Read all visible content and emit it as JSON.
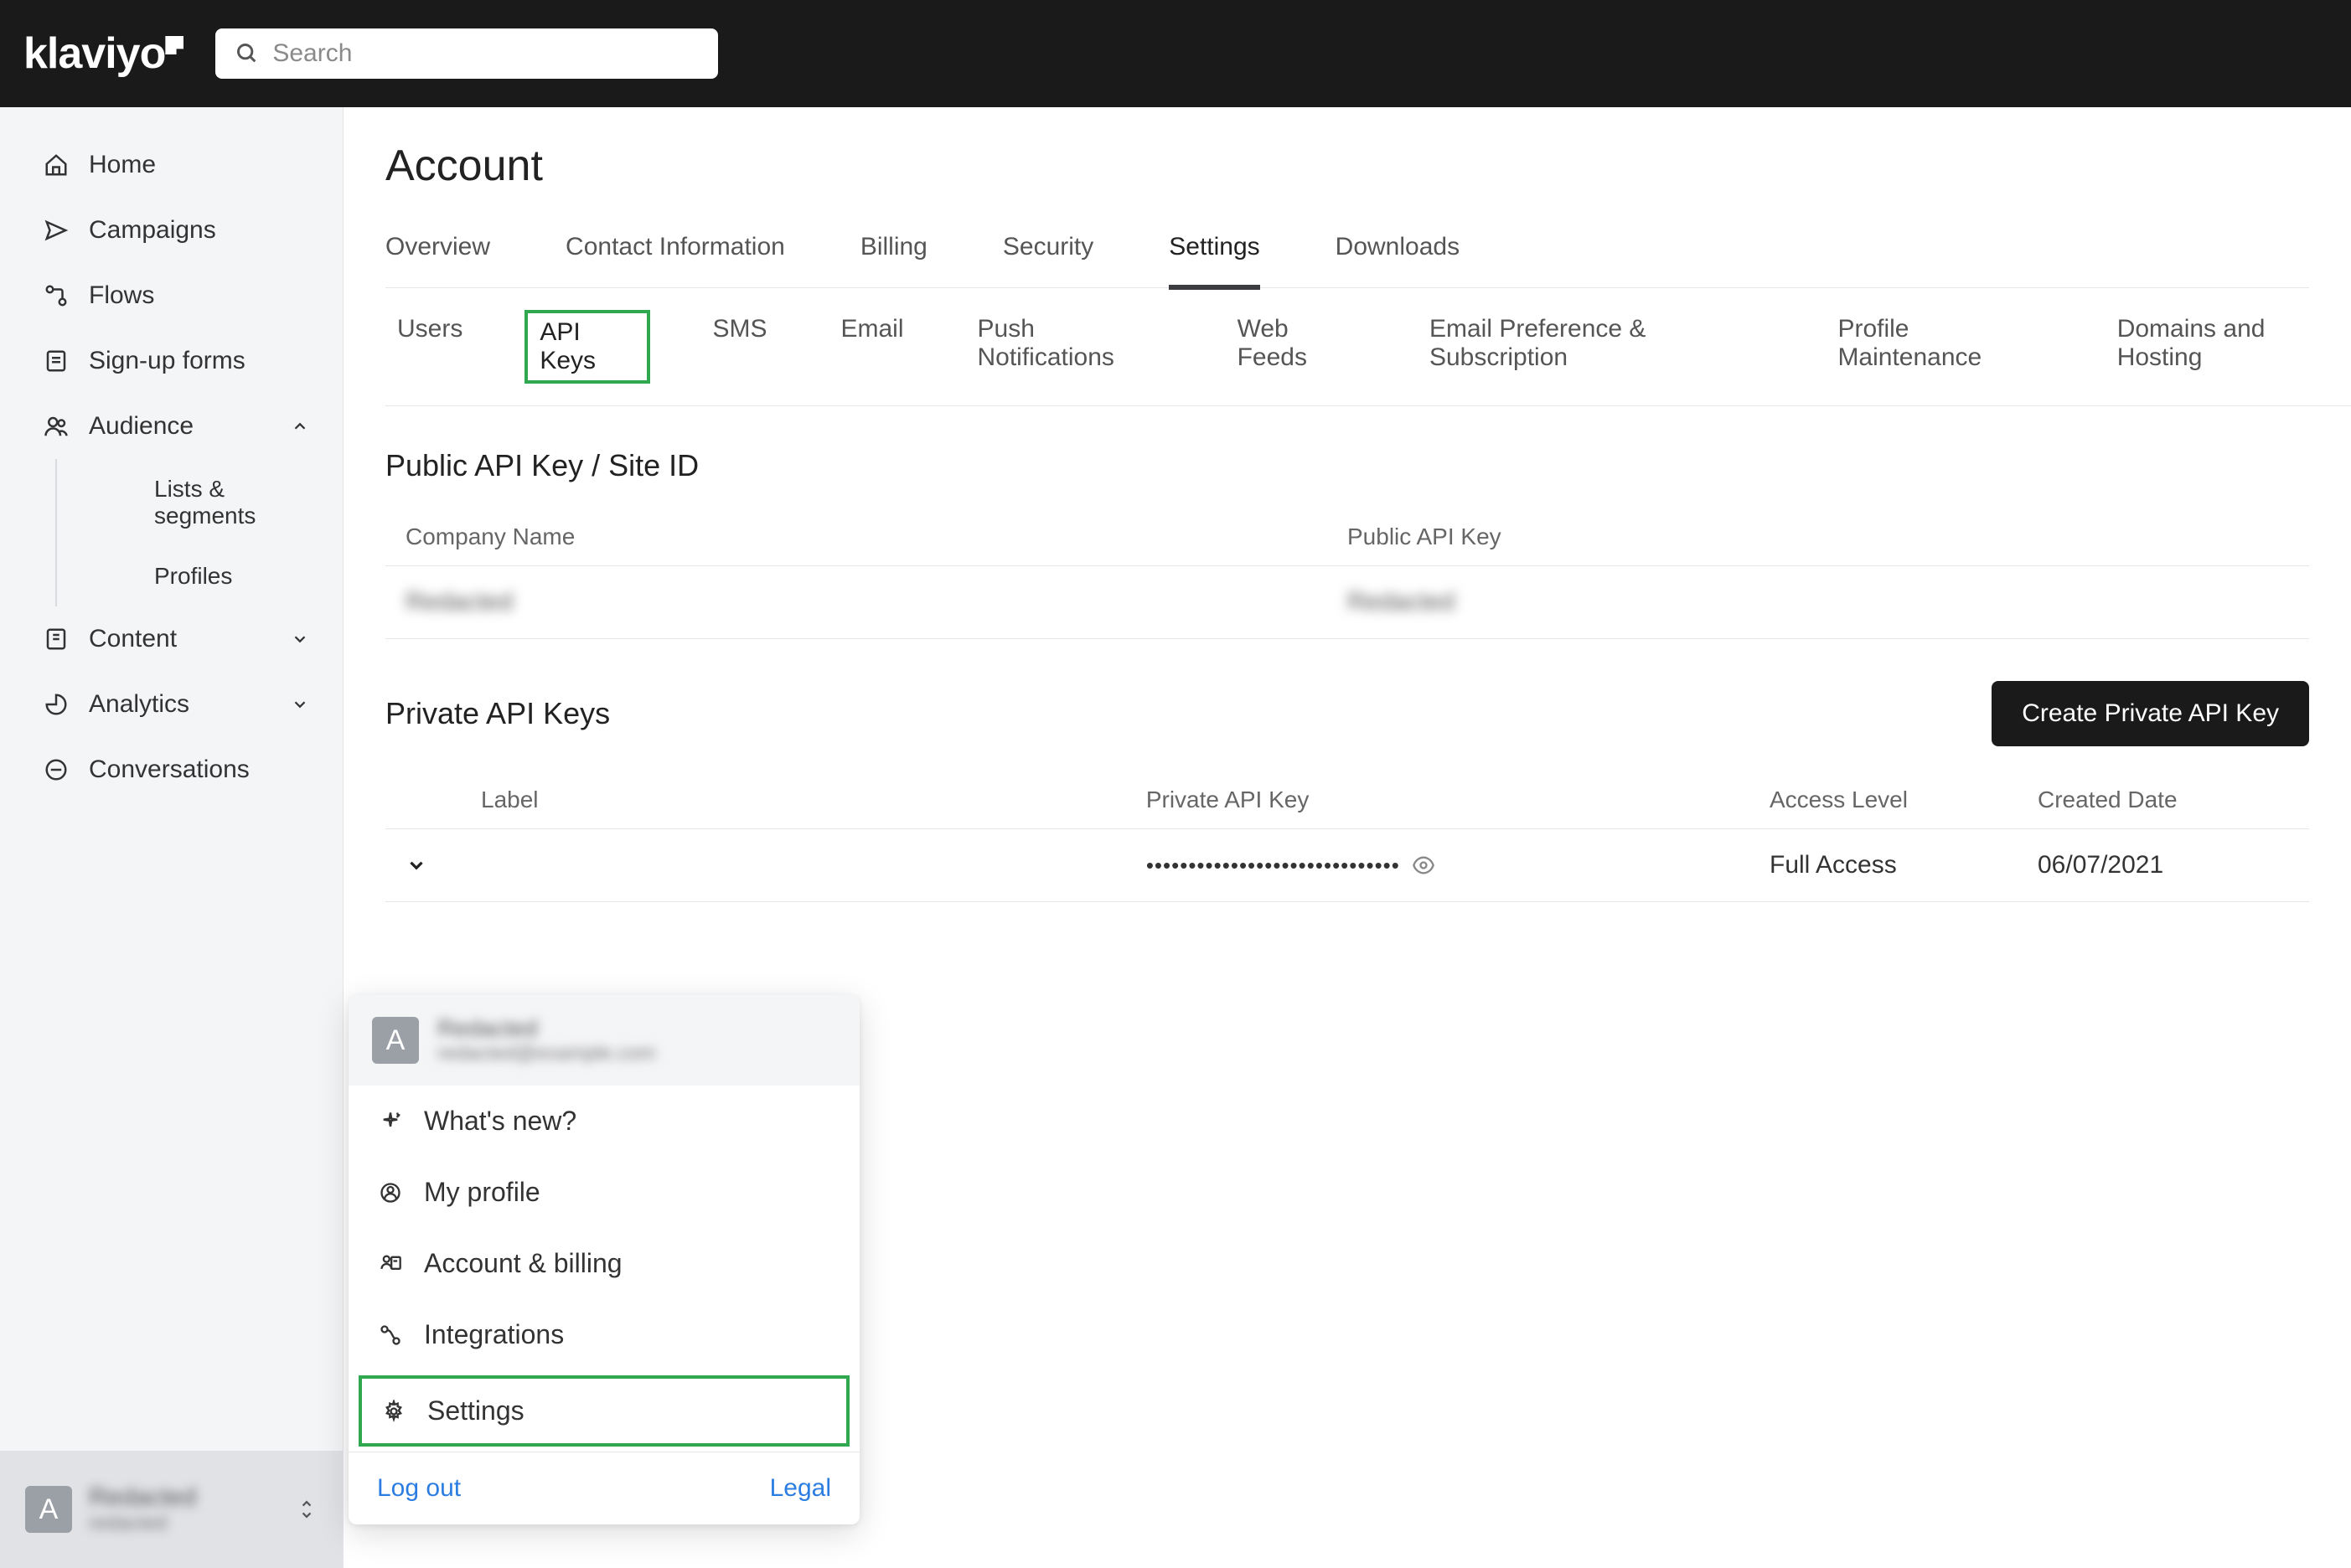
{
  "brand": "klaviyo",
  "search": {
    "placeholder": "Search"
  },
  "sidebar": {
    "items": [
      {
        "label": "Home"
      },
      {
        "label": "Campaigns"
      },
      {
        "label": "Flows"
      },
      {
        "label": "Sign-up forms"
      },
      {
        "label": "Audience",
        "expanded": true,
        "children": [
          {
            "label": "Lists & segments"
          },
          {
            "label": "Profiles"
          }
        ]
      },
      {
        "label": "Content",
        "expanded": false
      },
      {
        "label": "Analytics",
        "expanded": false
      },
      {
        "label": "Conversations"
      }
    ],
    "footer": {
      "avatar": "A",
      "name": "Redacted",
      "sub": "redacted"
    }
  },
  "page": {
    "title": "Account",
    "tabs_primary": [
      "Overview",
      "Contact Information",
      "Billing",
      "Security",
      "Settings",
      "Downloads"
    ],
    "active_primary": "Settings",
    "tabs_secondary": [
      "Users",
      "API Keys",
      "SMS",
      "Email",
      "Push Notifications",
      "Web Feeds",
      "Email Preference & Subscription",
      "Profile Maintenance",
      "Domains and Hosting"
    ],
    "active_secondary": "API Keys",
    "public_section": {
      "title": "Public API Key / Site ID",
      "headers": [
        "Company Name",
        "Public API Key"
      ],
      "rows": [
        {
          "company": "Redacted",
          "key": "Redacted"
        }
      ]
    },
    "private_section": {
      "title": "Private API Keys",
      "button": "Create Private API Key",
      "headers": [
        "Label",
        "Private API Key",
        "Access Level",
        "Created Date"
      ],
      "rows": [
        {
          "label": "",
          "key": "••••••••••••••••••••••••••••••",
          "access": "Full Access",
          "date": "06/07/2021"
        }
      ]
    }
  },
  "popover": {
    "avatar": "A",
    "name": "Redacted",
    "sub": "redacted@example.com",
    "items": [
      {
        "label": "What's new?"
      },
      {
        "label": "My profile"
      },
      {
        "label": "Account & billing"
      },
      {
        "label": "Integrations"
      },
      {
        "label": "Settings",
        "highlight": true
      }
    ],
    "footer": {
      "logout": "Log out",
      "legal": "Legal"
    }
  }
}
